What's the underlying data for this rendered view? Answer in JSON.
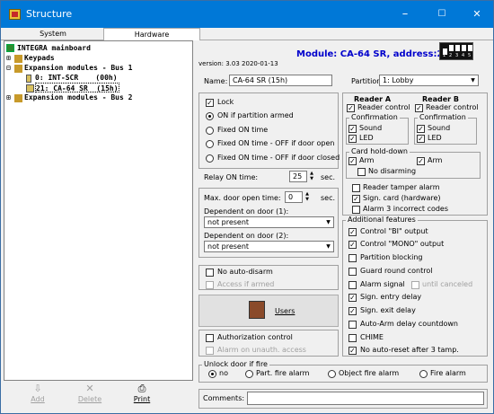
{
  "window": {
    "title": "Structure",
    "minimize": "–",
    "maximize": "☐",
    "close": "✕"
  },
  "tabs": [
    "System",
    "Hardware"
  ],
  "tree": {
    "root": "INTEGRA mainboard",
    "keypads": "Keypads",
    "bus1": "Expansion modules - Bus 1",
    "mod0": "0: INT-SCR    (00h)",
    "mod21": "21: CA-64 SR  (15h)",
    "bus2": "Expansion modules - Bus 2"
  },
  "left_buttons": {
    "add": "Add",
    "delete": "Delete",
    "print": "Print"
  },
  "header": {
    "version": "version: 3.03 2020-01-13",
    "module": "Module: CA-64 SR, address:21",
    "dip_numbers": [
      "1",
      "2",
      "3",
      "4",
      "5"
    ]
  },
  "name": {
    "label": "Name:",
    "value": "CA-64 SR  (15h)"
  },
  "partition": {
    "label": "Partition:",
    "value": "1: Lobby"
  },
  "lock": {
    "label": "Lock",
    "options": [
      "ON if partition armed",
      "Fixed ON time",
      "Fixed ON time - OFF if door open",
      "Fixed ON time - OFF if door closed"
    ]
  },
  "relay": {
    "label": "Relay ON time:",
    "value": "25",
    "unit": "sec."
  },
  "door_open": {
    "label": "Max. door open time:",
    "value": "0",
    "unit": "sec."
  },
  "dep1": {
    "label": "Dependent on door (1):",
    "value": "not present"
  },
  "dep2": {
    "label": "Dependent on door (2):",
    "value": "not present"
  },
  "no_auto_disarm": "No auto-disarm",
  "access_armed": "Access if armed",
  "users_button": "Users",
  "auth_control": "Authorization control",
  "alarm_unauth": "Alarm on unauth. access",
  "reader_a": {
    "title": "Reader A",
    "control": "Reader control"
  },
  "reader_b": {
    "title": "Reader B",
    "control": "Reader control"
  },
  "confirmation": {
    "title": "Confirmation",
    "sound": "Sound",
    "led": "LED"
  },
  "card_hold": {
    "title": "Card hold-down",
    "arm_a": "Arm",
    "arm_b": "Arm",
    "no_disarming": "No disarming"
  },
  "reader_opts": [
    "Reader tamper alarm",
    "Sign. card (hardware)",
    "Alarm 3 incorrect codes"
  ],
  "additional": {
    "title": "Additional features",
    "control_bi": "Control \"BI\" output",
    "control_mono": "Control \"MONO\" output",
    "partition_blocking": "Partition blocking",
    "guard_round": "Guard round control",
    "alarm_signal": "Alarm signal",
    "until_canceled": "until canceled",
    "sign_entry": "Sign. entry delay",
    "sign_exit": "Sign. exit delay",
    "auto_arm": "Auto-Arm delay countdown",
    "chime": "CHIME",
    "no_auto_reset": "No auto-reset after 3 tamp."
  },
  "unlock_fire": {
    "title": "Unlock door if fire",
    "options": [
      "no",
      "Part. fire alarm",
      "Object fire alarm",
      "Fire alarm"
    ]
  },
  "comments": {
    "label": "Comments:",
    "value": ""
  }
}
